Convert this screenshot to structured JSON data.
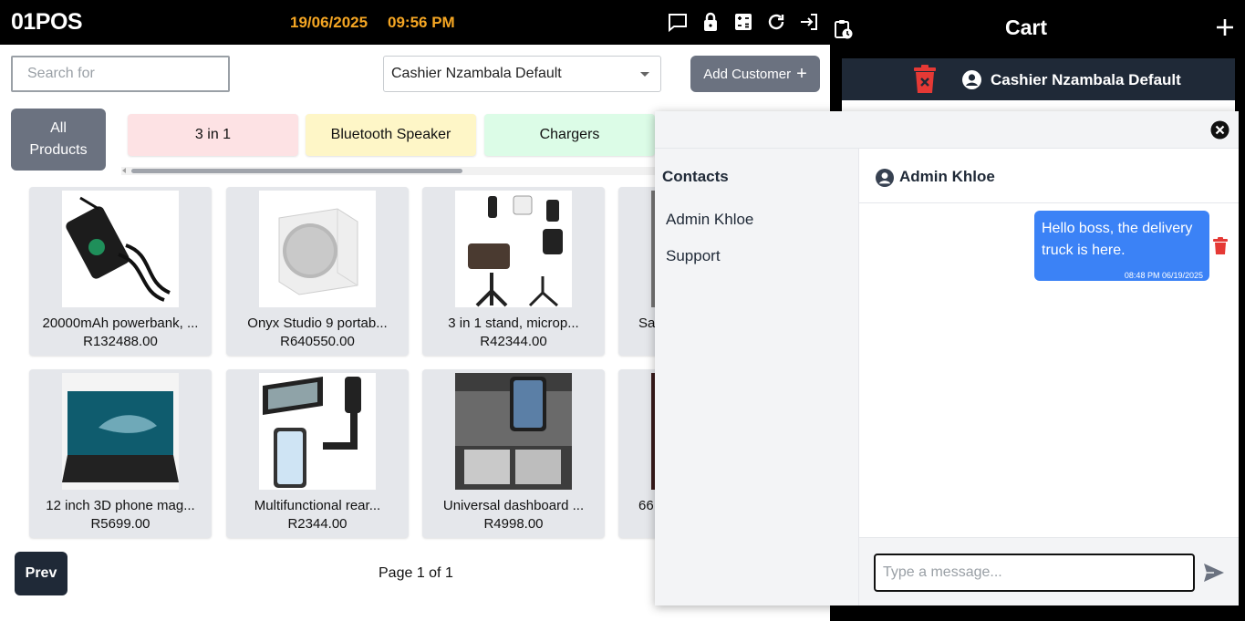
{
  "header": {
    "logo": "01POS",
    "date": "19/06/2025",
    "time": "09:56 PM",
    "icons": [
      "chat-icon",
      "lock-icon",
      "calculator-icon",
      "refresh-icon",
      "logout-icon",
      "clipboard-clock-icon"
    ]
  },
  "search": {
    "placeholder": "Search for"
  },
  "customer_select": {
    "value": "Cashier Nzambala Default"
  },
  "add_customer": {
    "label": "Add Customer"
  },
  "all_products": {
    "label_line1": "All",
    "label_line2": "Products"
  },
  "categories": [
    {
      "label": "3 in 1",
      "color": "#fde2e4"
    },
    {
      "label": "Bluetooth Speaker",
      "color": "#fef6c7"
    },
    {
      "label": "Chargers",
      "color": "#dcfce7"
    }
  ],
  "products": [
    {
      "name": "20000mAh powerbank, ...",
      "price": "R132488.00"
    },
    {
      "name": "Onyx Studio 9 portab...",
      "price": "R640550.00"
    },
    {
      "name": "3 in 1 stand, microp...",
      "price": "R42344.00"
    },
    {
      "name": "Sa",
      "price": ""
    },
    {
      "name": "12 inch 3D phone mag...",
      "price": "R5699.00"
    },
    {
      "name": "Multifunctional rear...",
      "price": "R2344.00"
    },
    {
      "name": "Universal dashboard ...",
      "price": "R4998.00"
    },
    {
      "name": "66",
      "price": ""
    }
  ],
  "pagination": {
    "prev_label": "Prev",
    "page_info": "Page 1 of 1"
  },
  "cart": {
    "title": "Cart",
    "customer": "Cashier Nzambala Default"
  },
  "chat": {
    "contacts_title": "Contacts",
    "contacts": [
      "Admin Khloe",
      "Support"
    ],
    "active_contact": "Admin Khloe",
    "messages": [
      {
        "text": "Hello boss, the delivery truck is here.",
        "time": "08:48 PM 06/19/2025"
      }
    ],
    "input_placeholder": "Type a message..."
  },
  "colors": {
    "accent_time": "#f5a623",
    "bubble": "#3b82f6",
    "button_gray": "#6b7280",
    "button_dark": "#1f2937",
    "danger": "#e53935"
  }
}
